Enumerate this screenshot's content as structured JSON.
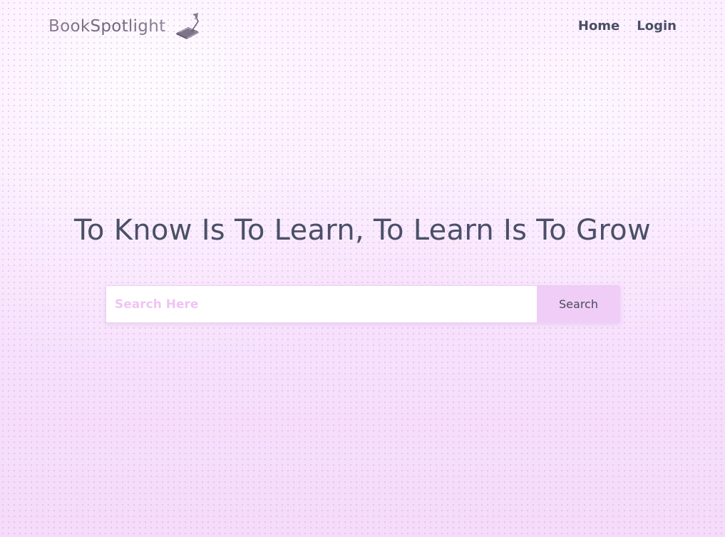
{
  "navbar": {
    "brand_name": "BookSpotlight",
    "brand_icon": "book-lamp-icon",
    "links": [
      {
        "label": "Home"
      },
      {
        "label": "Login"
      }
    ]
  },
  "hero": {
    "title": "To Know Is To Learn, To Learn Is To Grow"
  },
  "search": {
    "placeholder": "Search Here",
    "value": "",
    "button_label": "Search"
  },
  "colors": {
    "background": "#f8e2fd",
    "heading": "#4a5068",
    "placeholder": "#efc4f4",
    "button_bg": "#efcdf6"
  }
}
